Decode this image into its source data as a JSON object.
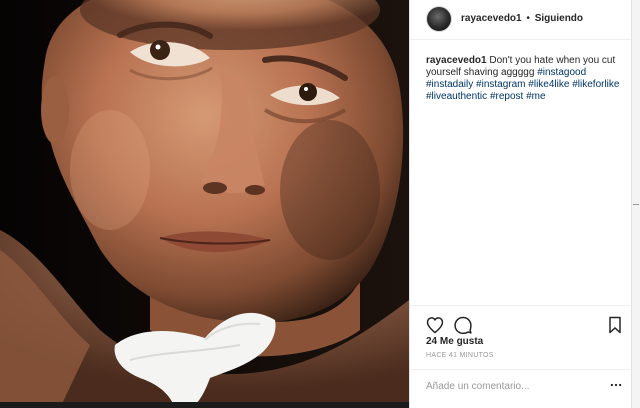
{
  "photo": {
    "description_icon": "portrait-photo"
  },
  "header": {
    "username": "rayacevedo1",
    "separator": "•",
    "follow_label": "Siguiendo"
  },
  "caption": {
    "username": "rayacevedo1",
    "text": "Don't you hate when you cut yourself shaving aggggg",
    "hashtags": [
      "#instagood",
      "#instadaily",
      "#instagram",
      "#like4like",
      "#likeforlike",
      "#liveauthentic",
      "#repost",
      "#me"
    ]
  },
  "actions": {
    "like_icon": "heart-icon",
    "comment_icon": "comment-icon",
    "save_icon": "bookmark-icon"
  },
  "likes_text": "24 Me gusta",
  "timestamp": "HACE 41 MINUTOS",
  "comment": {
    "placeholder": "Añade un comentario...",
    "more_icon": "more-options-icon"
  },
  "colors": {
    "hashtag": "#003569",
    "text": "#262626",
    "muted": "#999999"
  }
}
